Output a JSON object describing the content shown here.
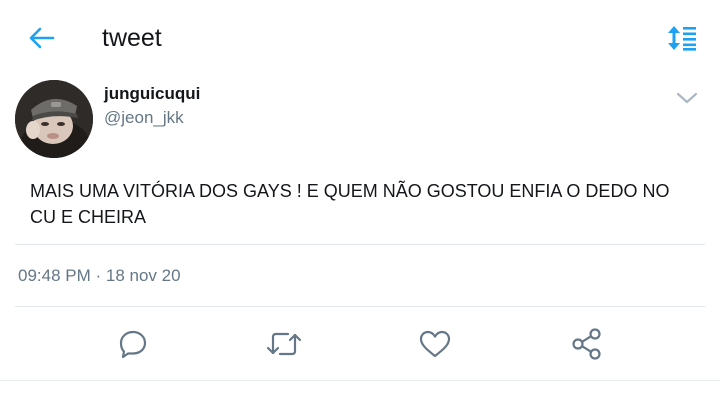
{
  "header": {
    "title": "tweet",
    "back_icon": "arrow-left-icon",
    "sort_icon": "sort-icon"
  },
  "tweet": {
    "display_name": "junguicuqui",
    "handle": "@jeon_jkk",
    "text": "MAIS UMA VITÓRIA DOS GAYS ! E QUEM NÃO GOSTOU ENFIA O DEDO NO CU E CHEIRA",
    "timestamp": "09:48 PM · 18 nov 20",
    "menu_icon": "chevron-down-icon"
  },
  "actions": [
    {
      "icon": "reply-icon"
    },
    {
      "icon": "retweet-icon"
    },
    {
      "icon": "like-icon"
    },
    {
      "icon": "share-icon"
    }
  ],
  "colors": {
    "accent": "#1da1f2",
    "text_primary": "#14171a",
    "text_secondary": "#657786",
    "icon_gray": "#657786",
    "divider": "#e1e8ed"
  }
}
